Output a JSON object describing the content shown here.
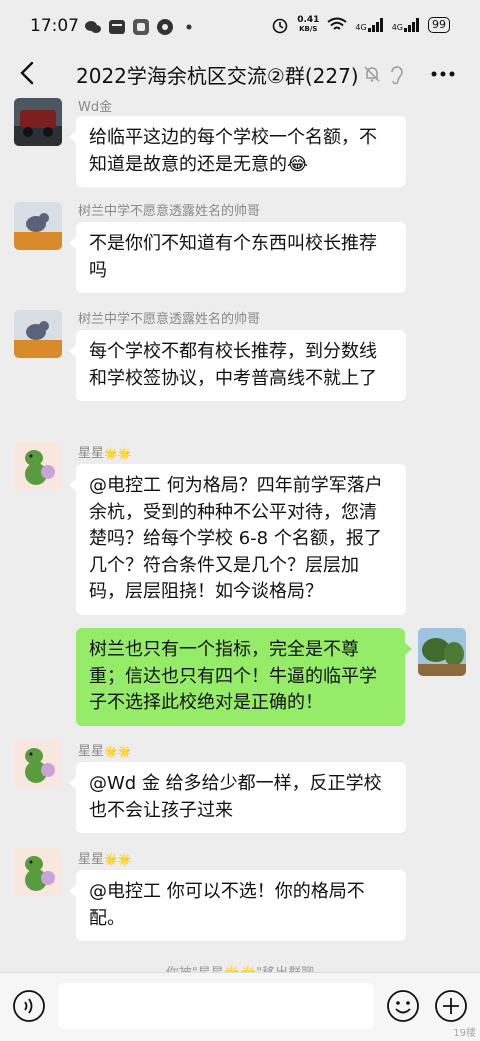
{
  "status_bar": {
    "time": "17:07",
    "net_speed_value": "0.41",
    "net_speed_unit": "KB/S",
    "signal1": "4G",
    "signal2": "4G",
    "battery": "99"
  },
  "header": {
    "title": "2022学海余杭区交流②群(227)",
    "icons": [
      "back-arrow-icon",
      "mute-bell-icon",
      "earpiece-icon",
      "more-icon"
    ]
  },
  "messages": [
    {
      "sender": "Wd金",
      "text": "给临平这边的每个学校一个名额，不知道是故意的还是无意的",
      "emoji": "😂"
    },
    {
      "sender": "树兰中学不愿意透露姓名的帅哥",
      "text": "不是你们不知道有个东西叫校长推荐吗"
    },
    {
      "sender": "树兰中学不愿意透露姓名的帅哥",
      "text": "每个学校不都有校长推荐，到分数线和学校签协议，中考普高线不就上了"
    },
    {
      "sender": "星星",
      "stars": "🌟🌟",
      "text": "@电控工  何为格局？四年前学军落户余杭，受到的种种不公平对待，您清楚吗？给每个学校 6-8 个名额，报了几个？符合条件又是几个？层层加码，层层阻挠！如今谈格局？"
    },
    {
      "sender": "",
      "text": "树兰也只有一个指标，完全是不尊重；信达也只有四个！牛逼的临平学子不选择此校绝对是正确的！"
    },
    {
      "sender": "星星",
      "stars": "🌟🌟",
      "text": "@Wd 金  给多给少都一样，反正学校也不会让孩子过来"
    },
    {
      "sender": "星星",
      "stars": "🌟🌟",
      "text": "@电控工  你可以不选！你的格局不配。"
    }
  ],
  "system_notice": "你被\"星星🌟🌟\"移出群聊",
  "input_bar": {
    "icons": [
      "voice-icon",
      "emoji-icon",
      "plus-icon"
    ]
  },
  "watermark": "19楼"
}
